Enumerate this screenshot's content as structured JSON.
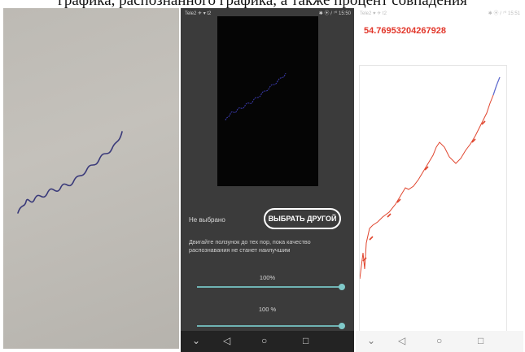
{
  "caption": "графика, распознанного графика, а также процент совпадения",
  "panel_app": {
    "status_left": "Tele2 ✈ ▾ t2",
    "status_right": "✱ ⦿ ᵢᴵ ⁷⁰ 15:50",
    "not_selected_label": "Не выбрано",
    "choose_button_label": "ВЫБРАТЬ ДРУГОЙ",
    "hint_text": "Двигайте ползунок до тех пор, пока качество распознавания не станет наилучшим",
    "slider1_label": "100%",
    "slider1_value": 100,
    "slider2_label": "100 %",
    "slider2_value": 100,
    "nav_icons": [
      "chevron-down-icon",
      "back-icon",
      "home-icon",
      "recents-icon"
    ]
  },
  "panel_result": {
    "status_left": "Tele2 ♥ ✈ t2",
    "status_right": "✱ ⦿ ᵢᴵ ⁷⁰ 15:51",
    "match_value": "54.76953204267928",
    "match_color": "#e2372b",
    "nav_icons": [
      "chevron-down-icon",
      "back-icon",
      "home-icon",
      "recents-icon"
    ]
  },
  "colors": {
    "app_background": "#3b3b3b",
    "accent_teal": "#6fb3b3",
    "ink": "#3a3a7a",
    "result_line": "#e0452e",
    "result_tail": "#5b6fd6"
  }
}
